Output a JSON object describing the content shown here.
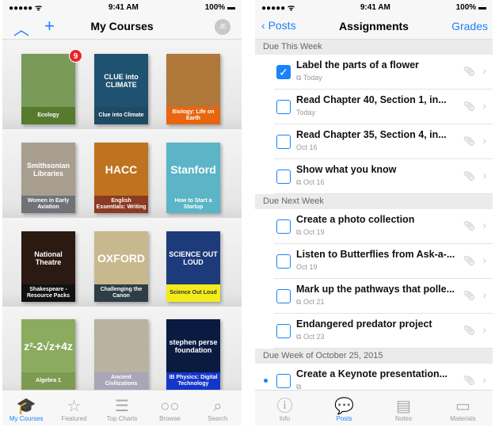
{
  "left": {
    "status": {
      "signal": "●●●●● ᯤ",
      "time": "9:41 AM",
      "battery": "100%"
    },
    "nav": {
      "title": "My Courses",
      "avatar": "JE"
    },
    "badge": "9",
    "books": [
      {
        "title": "Ecology",
        "color": "#567a2e",
        "art": "#7a9a5a"
      },
      {
        "title": "Clue into Climate",
        "color": "#1f4a63",
        "art": "#1f5270",
        "art_text": "CLUE into CLIMATE"
      },
      {
        "title": "Biology: Life on Earth",
        "color": "#e8660f",
        "art": "#b0773a"
      },
      {
        "title": "Women in Early Aviation",
        "color": "#6f7378",
        "art": "#a89e90",
        "art_text": "Smithsonian Libraries"
      },
      {
        "title": "English Essentials: Writing",
        "color": "#8a3b22",
        "art": "#c0731f",
        "art_text": "HACC"
      },
      {
        "title": "How to Start a Startup",
        "color": "#5bb5c6",
        "art": "#5bb5c6",
        "art_text": "Stanford"
      },
      {
        "title": "Shakespeare - Resource Packs",
        "color": "#111111",
        "art": "#2a1a12",
        "art_text": "National Theatre"
      },
      {
        "title": "Challenging the Canon",
        "color": "#2d3e45",
        "art": "#c8b88e",
        "art_text": "OXFORD"
      },
      {
        "title": "Science Out Loud",
        "color": "#f2ec1a",
        "art": "#1d3a7a",
        "art_text": "SCIENCE OUT LOUD"
      },
      {
        "title": "Algebra 1",
        "color": "#7e9a52",
        "art": "#8bab5e",
        "art_text": "z²-2√z+4z"
      },
      {
        "title": "Ancient Civilizations",
        "color": "#a9a6b8",
        "art": "#b9b2a0"
      },
      {
        "title": "IB Physics: Digital Technology",
        "color": "#1436c8",
        "art": "#0a1a40",
        "art_text": "stephen perse foundation"
      }
    ],
    "tabs": [
      {
        "label": "My Courses",
        "icon": "graduation-cap"
      },
      {
        "label": "Featured",
        "icon": "star"
      },
      {
        "label": "Top Charts",
        "icon": "list"
      },
      {
        "label": "Browse",
        "icon": "glasses"
      },
      {
        "label": "Search",
        "icon": "magnifier"
      }
    ]
  },
  "right": {
    "nav": {
      "back": "Posts",
      "title": "Assignments",
      "action": "Grades"
    },
    "sections": [
      {
        "header": "Due This Week",
        "items": [
          {
            "title": "Label the parts of a flower",
            "sub": "Today",
            "checked": true,
            "handout": true
          },
          {
            "title": "Read Chapter 40, Section 1, in...",
            "sub": "Today",
            "checked": false,
            "handout": false
          },
          {
            "title": "Read Chapter 35, Section 4, in...",
            "sub": "Oct 16",
            "checked": false,
            "handout": false
          },
          {
            "title": "Show what you know",
            "sub": "Oct 16",
            "checked": false,
            "handout": true
          }
        ]
      },
      {
        "header": "Due Next Week",
        "items": [
          {
            "title": "Create a photo collection",
            "sub": "Oct 19",
            "checked": false,
            "handout": true
          },
          {
            "title": "Listen to Butterflies from Ask-a-...",
            "sub": "Oct 19",
            "checked": false,
            "handout": false
          },
          {
            "title": "Mark up the pathways that polle...",
            "sub": "Oct 21",
            "checked": false,
            "handout": true
          },
          {
            "title": "Endangered predator project",
            "sub": "Oct 23",
            "checked": false,
            "handout": true
          }
        ]
      },
      {
        "header": "Due Week of October 25, 2015",
        "items": [
          {
            "title": "Create a Keynote presentation...",
            "sub": "",
            "checked": false,
            "handout": true,
            "unread": true
          }
        ]
      }
    ],
    "tabs": [
      {
        "label": "Info",
        "icon": "info"
      },
      {
        "label": "Posts",
        "icon": "speech-bubble"
      },
      {
        "label": "Notes",
        "icon": "document"
      },
      {
        "label": "Materials",
        "icon": "box"
      }
    ]
  },
  "colors": {
    "accent": "#1a82fb",
    "badge": "#e8232b"
  }
}
